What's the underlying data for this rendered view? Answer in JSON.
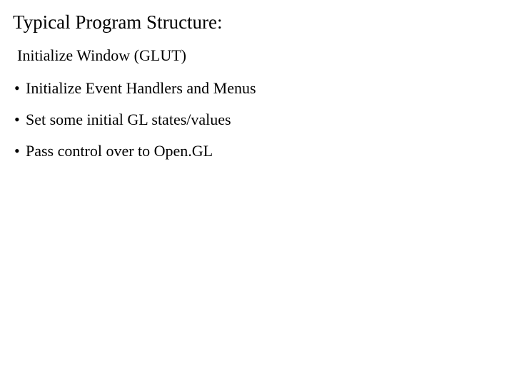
{
  "slide": {
    "title": "Typical Program Structure:",
    "subtitle": "Initialize Window (GLUT)",
    "bullets": [
      "Initialize Event Handlers and Menus",
      "Set some initial GL states/values",
      "Pass control over to Open.GL"
    ]
  }
}
